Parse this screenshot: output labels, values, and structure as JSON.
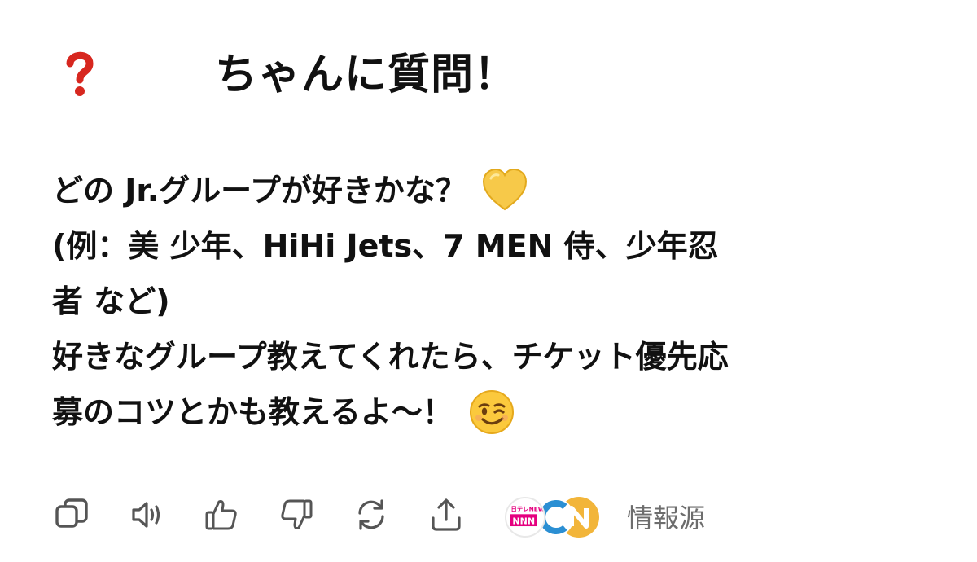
{
  "header": {
    "title": "ちゃんに質問！",
    "question_icon": "red-question-mark-icon"
  },
  "message": {
    "lines": [
      "どの Jr.グループが好きかな？",
      "(例：美 少年、HiHi Jets、7 MEN 侍、少年忍",
      "者 など)",
      "好きなグループ教えてくれたら、チケット優先応",
      "募のコツとかも教えるよ〜！"
    ],
    "line1_emoji": "yellow-heart-icon",
    "line5_emoji": "winking-face-icon"
  },
  "toolbar": {
    "icons": [
      "copy-icon",
      "speaker-icon",
      "thumbs-up-icon",
      "thumbs-down-icon",
      "regenerate-icon",
      "share-icon"
    ],
    "sources_label": "情報源",
    "source_logo_text": "日テレNEWS"
  },
  "colors": {
    "question_red": "#d7271f",
    "icon_gray": "#555555",
    "heart_yellow": "#f7c949",
    "source_blue": "#2b8fd3",
    "source_orange": "#f2b53a",
    "source_red": "#e5007f"
  }
}
